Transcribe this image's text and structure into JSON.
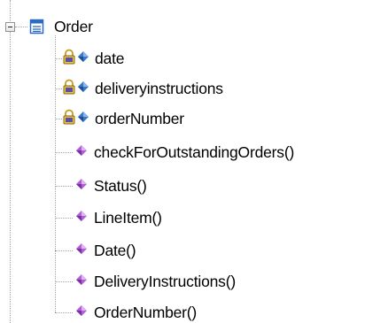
{
  "tree": {
    "class_node": {
      "label": "Order",
      "expanded": true,
      "icon": "class-icon"
    },
    "attributes": [
      {
        "label": "date",
        "icon": "attribute-icon",
        "lock": "lock-icon"
      },
      {
        "label": "deliveryinstructions",
        "icon": "attribute-icon",
        "lock": "lock-icon"
      },
      {
        "label": "orderNumber",
        "icon": "attribute-icon",
        "lock": "lock-icon"
      }
    ],
    "operations": [
      {
        "label": "checkForOutstandingOrders()",
        "icon": "operation-icon"
      },
      {
        "label": "Status()",
        "icon": "operation-icon"
      },
      {
        "label": "LineItem()",
        "icon": "operation-icon"
      },
      {
        "label": "Date()",
        "icon": "operation-icon"
      },
      {
        "label": "DeliveryInstructions()",
        "icon": "operation-icon"
      },
      {
        "label": "OrderNumber()",
        "icon": "operation-icon"
      }
    ]
  },
  "colors": {
    "class_icon_blue": "#2d6bc2",
    "attribute_blue": "#3a78c9",
    "operation_purple": "#b05fd6",
    "lock_gold": "#c79a1c",
    "lock_body": "#5a4fa8",
    "tree_lines": "#a0a0a0"
  }
}
